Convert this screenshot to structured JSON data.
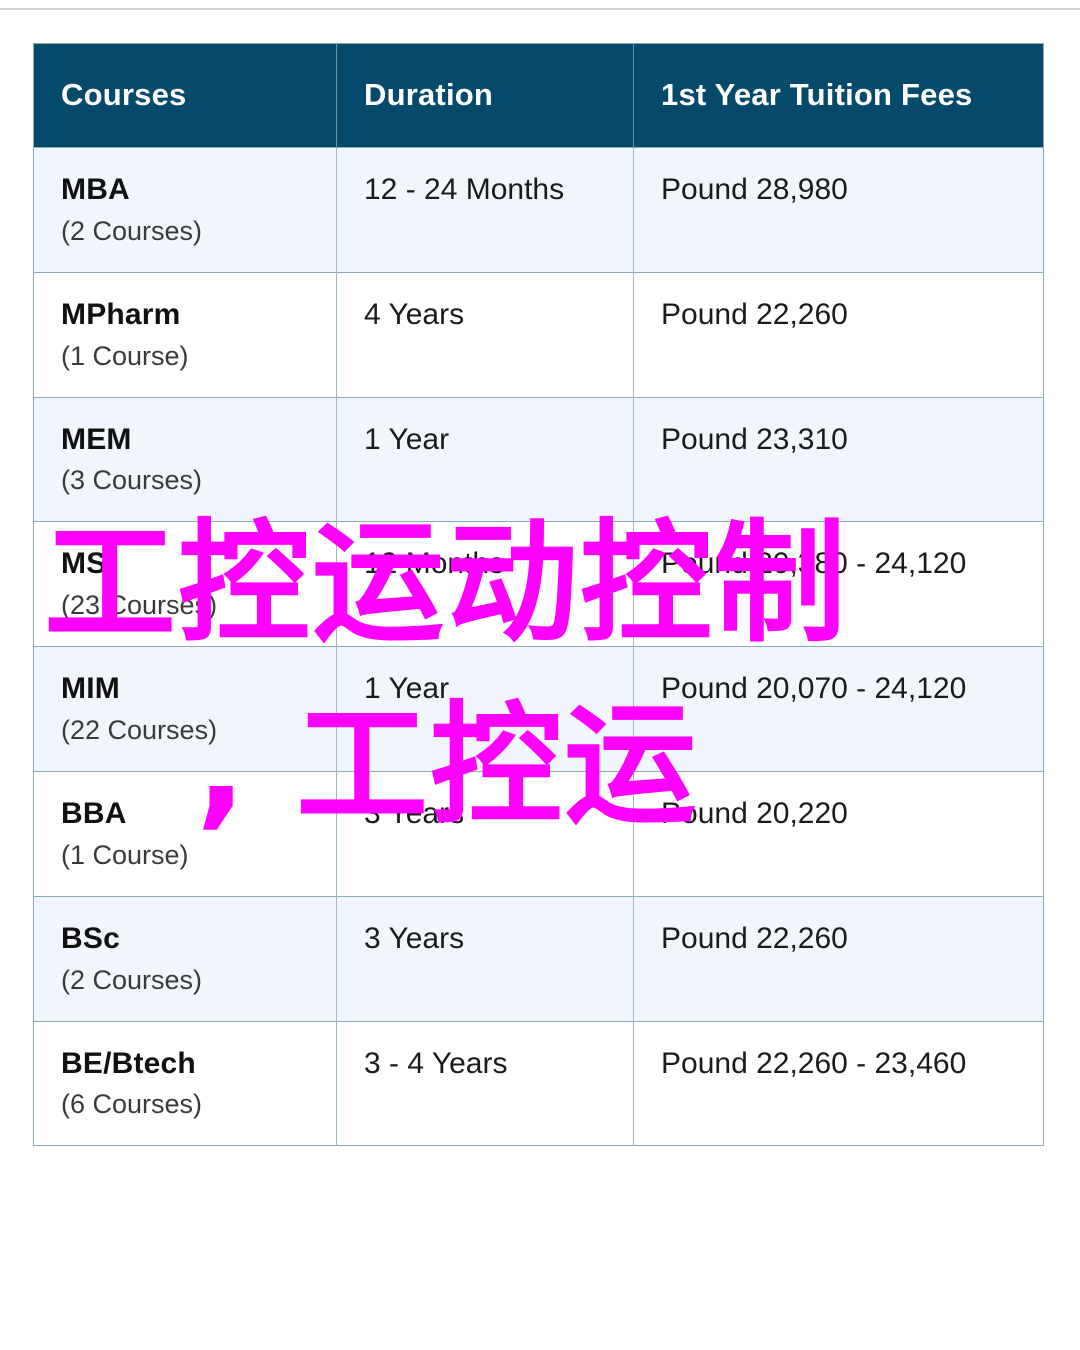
{
  "table": {
    "headers": [
      "Courses",
      "Duration",
      "1st Year Tuition Fees"
    ],
    "rows": [
      {
        "course": "MBA",
        "count": "(2 Courses)",
        "duration": "12 - 24 Months",
        "fees": "Pound 28,980",
        "tint": true
      },
      {
        "course": "MPharm",
        "count": "(1 Course)",
        "duration": "4 Years",
        "fees": "Pound 22,260",
        "tint": false
      },
      {
        "course": "MEM",
        "count": "(3 Courses)",
        "duration": "1 Year",
        "fees": "Pound 23,310",
        "tint": true
      },
      {
        "course": "MS",
        "count": "(23 Courses)",
        "duration": "12 Months",
        "fees": "Pound 20,380 - 24,120",
        "tint": false
      },
      {
        "course": "MIM",
        "count": "(22 Courses)",
        "duration": "1 Year",
        "fees": "Pound 20,070 - 24,120",
        "tint": true
      },
      {
        "course": "BBA",
        "count": "(1 Course)",
        "duration": "3 Years",
        "fees": "Pound 20,220",
        "tint": false
      },
      {
        "course": "BSc",
        "count": "(2 Courses)",
        "duration": "3 Years",
        "fees": "Pound 22,260",
        "tint": true
      },
      {
        "course": "BE/Btech",
        "count": "(6 Courses)",
        "duration": "3 - 4 Years",
        "fees": "Pound 22,260 - 23,460",
        "tint": false
      }
    ]
  },
  "watermark": {
    "line1": "工控运动控制",
    "line2": ", 工控运",
    "color": "#ff00ff"
  },
  "colors": {
    "header_background": "#064a6b",
    "header_text": "#ffffff",
    "row_tint": "#f1f6fd",
    "row_plain": "#ffffff",
    "grid_line": "#8aacb2",
    "body_text": "#1b1b1b"
  }
}
